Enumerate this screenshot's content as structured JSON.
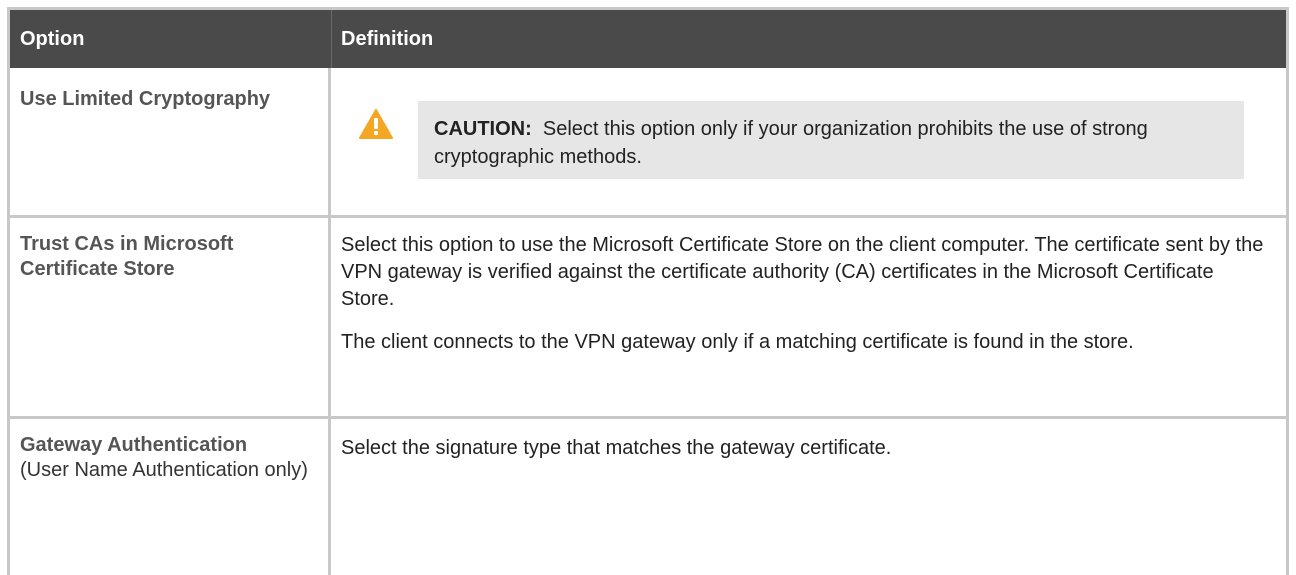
{
  "table": {
    "headers": {
      "option": "Option",
      "definition": "Definition"
    },
    "rows": [
      {
        "option": "Use Limited Cryptography",
        "caution": {
          "label": "CAUTION:",
          "text": "Select this option only if your organization prohibits the use of strong cryptographic methods.",
          "icon": "warning-icon",
          "icon_color": "#f5a623"
        }
      },
      {
        "option": "Trust CAs in Microsoft Certificate Store",
        "paragraphs": [
          "Select this option to use the Microsoft Certificate Store on the client computer. The certificate sent by the VPN gateway is verified against the certificate authority (CA) certificates in the Microsoft Certificate Store.",
          "The client connects to the VPN gateway only if a matching certificate is found in the store."
        ]
      },
      {
        "option": "Gateway Authentication",
        "option_note": "(User Name Authentication only)",
        "paragraphs": [
          "Select the signature type that matches the gateway certificate."
        ]
      }
    ]
  },
  "colors": {
    "header_bg": "#4a4a4a",
    "header_text": "#ffffff",
    "border": "#c8c8c8",
    "caution_bg": "#e6e6e6",
    "option_text": "#555555"
  }
}
